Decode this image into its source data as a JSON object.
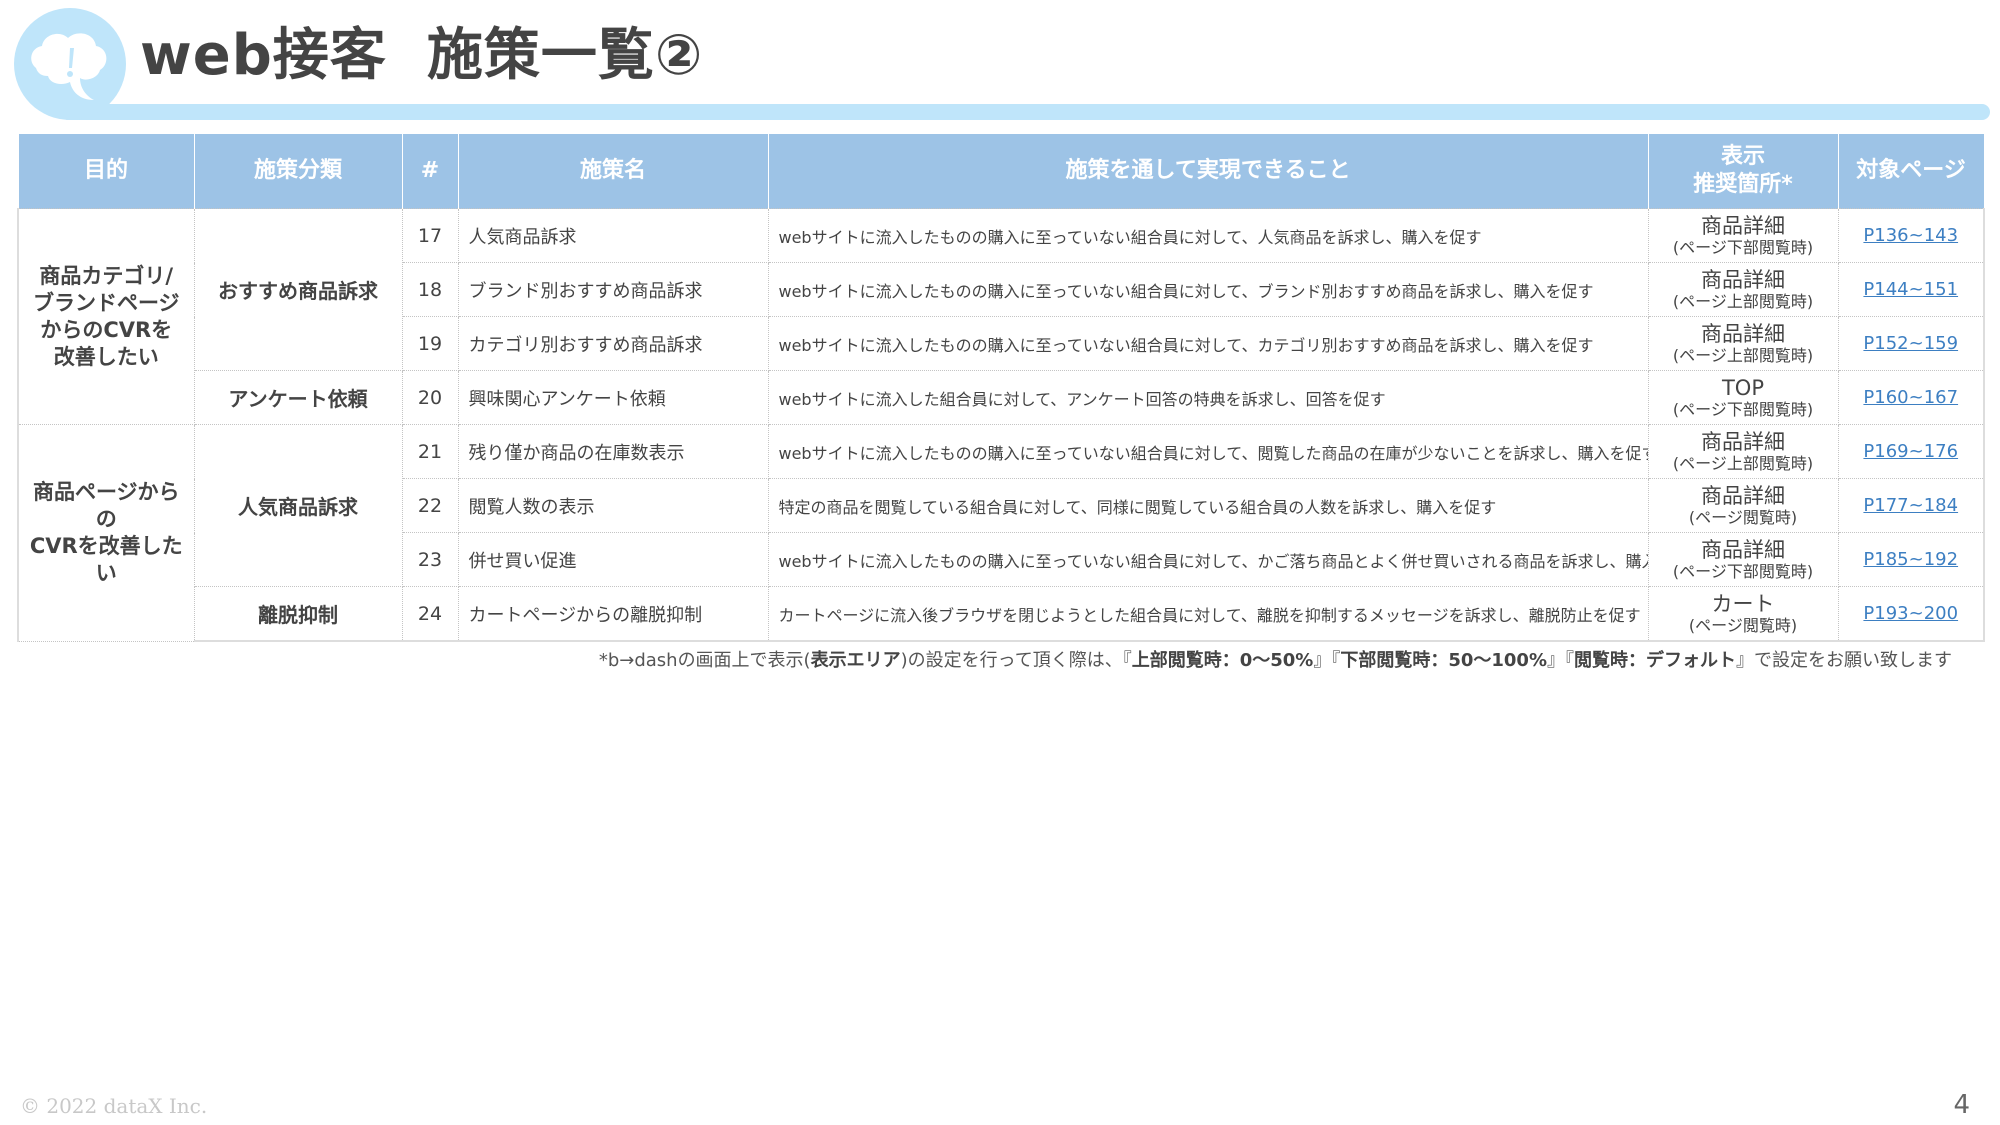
{
  "header": {
    "title_part1": "web接客",
    "title_part2": "施策一覧②"
  },
  "colors": {
    "header_fill": "#9dc3e6",
    "accent_bar": "#bfe5fa",
    "link": "#3d7fc2"
  },
  "icons": {
    "logo": "speech-bubble-exclamation-icon"
  },
  "table": {
    "headers": {
      "purpose": "目的",
      "category": "施策分類",
      "num": "#",
      "name": "施策名",
      "realize": "施策を通して実現できること",
      "location_line1": "表示",
      "location_line2": "推奨箇所*",
      "page": "対象ページ"
    },
    "purposes": [
      {
        "lines": [
          "商品カテゴリ/",
          "ブランドページ",
          "からのCVRを",
          "改善したい"
        ]
      },
      {
        "lines": [
          "商品ページからの",
          "CVRを改善したい"
        ]
      }
    ],
    "categories": [
      "おすすめ商品訴求",
      "アンケート依頼",
      "人気商品訴求",
      "離脱抑制"
    ],
    "rows": [
      {
        "num": "17",
        "name": "人気商品訴求",
        "desc": "webサイトに流入したものの購入に至っていない組合員に対して、人気商品を訴求し、購入を促す",
        "loc_main": "商品詳細",
        "loc_sub": "(ページ下部閲覧時)",
        "page": "P136~143"
      },
      {
        "num": "18",
        "name": "ブランド別おすすめ商品訴求",
        "desc": "webサイトに流入したものの購入に至っていない組合員に対して、ブランド別おすすめ商品を訴求し、購入を促す",
        "loc_main": "商品詳細",
        "loc_sub": "(ページ上部閲覧時)",
        "page": "P144~151"
      },
      {
        "num": "19",
        "name": "カテゴリ別おすすめ商品訴求",
        "desc": "webサイトに流入したものの購入に至っていない組合員に対して、カテゴリ別おすすめ商品を訴求し、購入を促す",
        "loc_main": "商品詳細",
        "loc_sub": "(ページ上部閲覧時)",
        "page": "P152~159"
      },
      {
        "num": "20",
        "name": "興味関心アンケート依頼",
        "desc": "webサイトに流入した組合員に対して、アンケート回答の特典を訴求し、回答を促す",
        "loc_main": "TOP",
        "loc_sub": "(ページ下部閲覧時)",
        "page": "P160~167"
      },
      {
        "num": "21",
        "name": "残り僅か商品の在庫数表示",
        "desc": "webサイトに流入したものの購入に至っていない組合員に対して、閲覧した商品の在庫が少ないことを訴求し、購入を促す",
        "loc_main": "商品詳細",
        "loc_sub": "(ページ上部閲覧時)",
        "page": "P169~176"
      },
      {
        "num": "22",
        "name": "閲覧人数の表示",
        "desc": "特定の商品を閲覧している組合員に対して、同様に閲覧している組合員の人数を訴求し、購入を促す",
        "loc_main": "商品詳細",
        "loc_sub": "(ページ閲覧時)",
        "page": "P177~184"
      },
      {
        "num": "23",
        "name": "併せ買い促進",
        "desc": "webサイトに流入したものの購入に至っていない組合員に対して、かご落ち商品とよく併せ買いされる商品を訴求し、購入を促す",
        "loc_main": "商品詳細",
        "loc_sub": "(ページ下部閲覧時)",
        "page": "P185~192"
      },
      {
        "num": "24",
        "name": "カートページからの離脱抑制",
        "desc": "カートページに流入後ブラウザを閉じようとした組合員に対して、離脱を抑制するメッセージを訴求し、離脱防止を促す",
        "loc_main": "カート",
        "loc_sub": "(ページ閲覧時)",
        "page": "P193~200"
      }
    ]
  },
  "footnote": {
    "pre": "*b→dashの画面上で表示(",
    "area": "表示エリア",
    "mid": ")の設定を行って頂く際は、『",
    "upper": "上部閲覧時：0～50%",
    "sep1": "』『",
    "lower": "下部閲覧時：50～100%",
    "sep2": "』『",
    "view": "閲覧時：デフォルト",
    "post": "』で設定をお願い致します"
  },
  "footer": {
    "copyright": "© 2022 dataX Inc.",
    "page_number": "4"
  }
}
